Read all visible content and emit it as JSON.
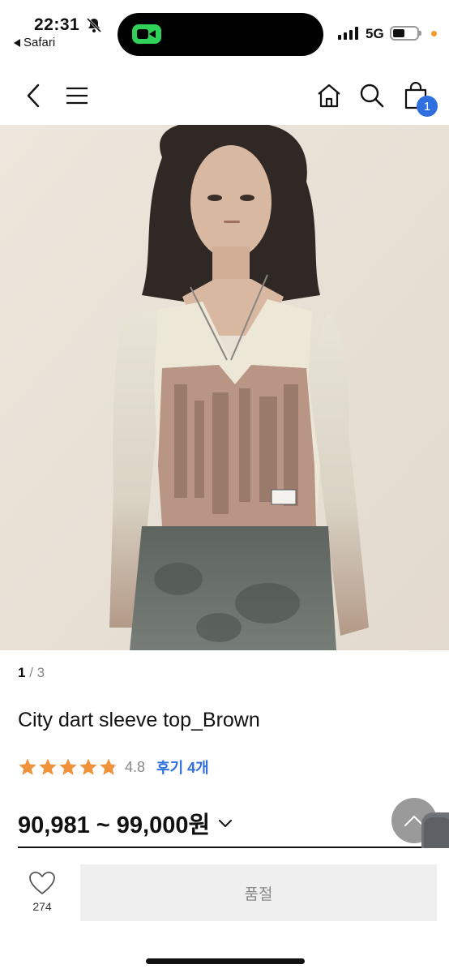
{
  "status_bar": {
    "time": "22:31",
    "back_app": "Safari",
    "network": "5G"
  },
  "nav": {
    "cart_count": "1"
  },
  "icons": {
    "back": "chevron-left-icon",
    "menu": "hamburger-menu-icon",
    "home": "home-icon",
    "search": "search-icon",
    "cart": "shopping-bag-icon",
    "like": "heart-icon"
  },
  "gallery": {
    "current": "1",
    "separator": " / ",
    "total": "3"
  },
  "product": {
    "title": "City dart sleeve top_Brown",
    "rating": "4.8",
    "rating_value": 4.8,
    "reviews_label": "후기 4개",
    "price": "90,981 ~ 99,000원"
  },
  "bottom": {
    "like_count": "274",
    "buy_label": "품절"
  },
  "colors": {
    "accent": "#2f6fe0",
    "star": "#f0923a",
    "soldout_bg": "#efefef"
  }
}
